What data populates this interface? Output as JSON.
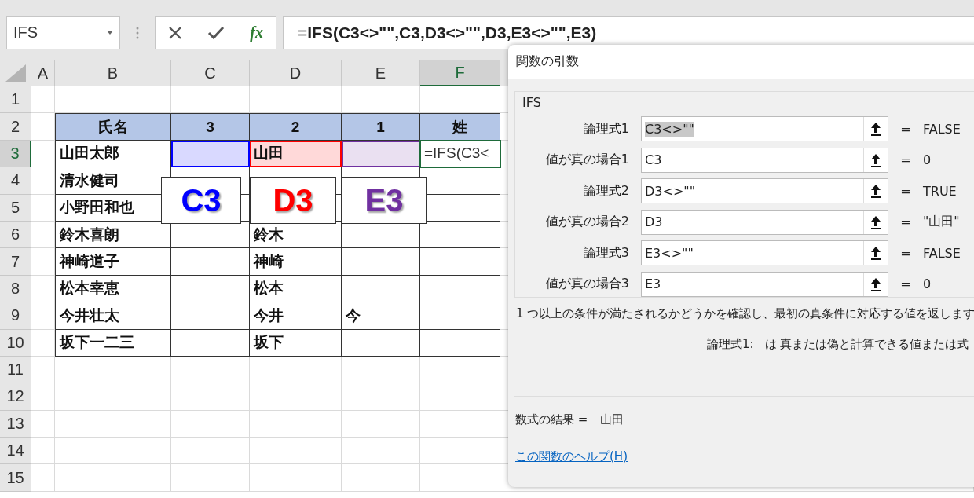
{
  "name_box": {
    "value": "IFS"
  },
  "formula_bar": {
    "fx": "fx",
    "value": "=**IFS(C3<>\"\",C3,D3<>\"\",D3,E3<>\"\",E3)**"
  },
  "columns": [
    {
      "label": "A",
      "selected": false
    },
    {
      "label": "B",
      "selected": false
    },
    {
      "label": "C",
      "selected": false
    },
    {
      "label": "D",
      "selected": false
    },
    {
      "label": "E",
      "selected": false
    },
    {
      "label": "F",
      "selected": true
    }
  ],
  "rows": [
    {
      "label": "1",
      "selected": false,
      "kind": "blank",
      "cells": {}
    },
    {
      "label": "2",
      "selected": false,
      "kind": "header",
      "cells": {
        "B": "氏名",
        "C": "3",
        "D": "2",
        "E": "1",
        "F": "姓"
      }
    },
    {
      "label": "3",
      "selected": true,
      "kind": "data",
      "cells": {
        "B": "山田太郎",
        "D": "山田",
        "F": "=IFS(C3<"
      }
    },
    {
      "label": "4",
      "selected": false,
      "kind": "data",
      "cells": {
        "B": "清水健司"
      }
    },
    {
      "label": "5",
      "selected": false,
      "kind": "data",
      "cells": {
        "B": "小野田和也"
      }
    },
    {
      "label": "6",
      "selected": false,
      "kind": "data",
      "cells": {
        "B": "鈴木喜朗",
        "D": "鈴木"
      }
    },
    {
      "label": "7",
      "selected": false,
      "kind": "data",
      "cells": {
        "B": "神崎道子",
        "D": "神崎"
      }
    },
    {
      "label": "8",
      "selected": false,
      "kind": "data",
      "cells": {
        "B": "松本幸恵",
        "D": "松本"
      }
    },
    {
      "label": "9",
      "selected": false,
      "kind": "data",
      "cells": {
        "B": "今井壮太",
        "D": "今井",
        "E": "今"
      }
    },
    {
      "label": "10",
      "selected": false,
      "kind": "data",
      "cells": {
        "B": "坂下一二三",
        "D": "坂下"
      }
    },
    {
      "label": "11",
      "selected": false,
      "kind": "blank",
      "cells": {}
    },
    {
      "label": "12",
      "selected": false,
      "kind": "blank",
      "cells": {}
    },
    {
      "label": "13",
      "selected": false,
      "kind": "blank",
      "cells": {}
    },
    {
      "label": "14",
      "selected": false,
      "kind": "blank",
      "cells": {}
    },
    {
      "label": "15",
      "selected": false,
      "kind": "blank",
      "cells": {}
    }
  ],
  "references": [
    {
      "label": "C3",
      "color": "#0000ff"
    },
    {
      "label": "D3",
      "color": "#ff0000"
    },
    {
      "label": "E3",
      "color": "#7030a0"
    }
  ],
  "dialog": {
    "title": "関数の引数",
    "function": "IFS",
    "arguments": [
      {
        "label": "論理式1",
        "value": "C3<>\"\"",
        "selected": true,
        "result": "FALSE"
      },
      {
        "label": "値が真の場合1",
        "value": "C3",
        "selected": false,
        "result": "0"
      },
      {
        "label": "論理式2",
        "value": "D3<>\"\"",
        "selected": false,
        "result": "TRUE"
      },
      {
        "label": "値が真の場合2",
        "value": "D3",
        "selected": false,
        "result": "\"山田\""
      },
      {
        "label": "論理式3",
        "value": "E3<>\"\"",
        "selected": false,
        "result": "FALSE"
      },
      {
        "label": "値が真の場合3",
        "value": "E3",
        "selected": false,
        "result": "0"
      }
    ],
    "equals": "=",
    "description": "1 つ以上の条件が満たされるかどうかを確認し、最初の真条件に対応する値を返します",
    "hint_label": "論理式1:",
    "hint_text": "は 真または偽と計算できる値または式",
    "result_label": "数式の結果 =",
    "result_value": "山田",
    "help_link": "この関数のヘルプ(H)"
  }
}
